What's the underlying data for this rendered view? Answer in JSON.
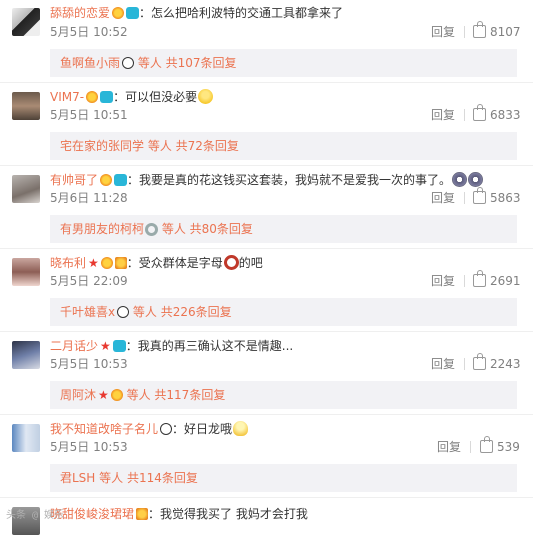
{
  "reply_label": "回复",
  "comments": [
    {
      "avatar": "avatar-image",
      "username": "舔舔的恋爱",
      "text": "：怎么把哈利波特的交通工具都拿来了",
      "time": "5月5日 10:52",
      "likes": "8107",
      "subreplies": {
        "user": "鱼啊鱼小雨",
        "summary": " 等人 共107条回复"
      }
    },
    {
      "avatar": "avatar-image",
      "username": "VIM7-",
      "text": "：可以但没必要",
      "time": "5月5日 10:51",
      "likes": "6833",
      "subreplies": {
        "user": "宅在家的张同学",
        "summary": " 等人 共72条回复"
      }
    },
    {
      "avatar": "avatar-image",
      "username": "有帅哥了",
      "text": "：我要是真的花这钱买这套装，我妈就不是爱我一次的事了。",
      "time": "5月6日 11:28",
      "likes": "5863",
      "subreplies": {
        "user": "有男朋友的柯柯",
        "summary": " 等人 共80条回复"
      }
    },
    {
      "avatar": "avatar-image",
      "username": "晓布利",
      "text": "：受众群体是字母",
      "text_after": "的吧",
      "time": "5月5日 22:09",
      "likes": "2691",
      "subreplies": {
        "user": "千叶雄喜x",
        "summary": " 等人 共226条回复"
      }
    },
    {
      "avatar": "avatar-image",
      "username": "二月话少",
      "text": "：我真的再三确认这不是情趣...",
      "time": "5月5日 10:53",
      "likes": "2243",
      "subreplies": {
        "user": "周阿沐",
        "summary": " 等人 共117条回复"
      }
    },
    {
      "avatar": "avatar-image",
      "username": "我不知道改啥子名儿",
      "text": "：好日龙哦",
      "time": "5月5日 10:53",
      "likes": "539",
      "subreplies": {
        "user": "君LSH",
        "summary": " 等人 共114条回复"
      }
    },
    {
      "avatar": "avatar-image",
      "username": "晓甜俊峻浚珺珺",
      "text": "：我觉得我买了 我妈才会打我",
      "time": "",
      "likes": "",
      "subreplies": null
    }
  ],
  "watermark": "头条 @ 娱乐"
}
